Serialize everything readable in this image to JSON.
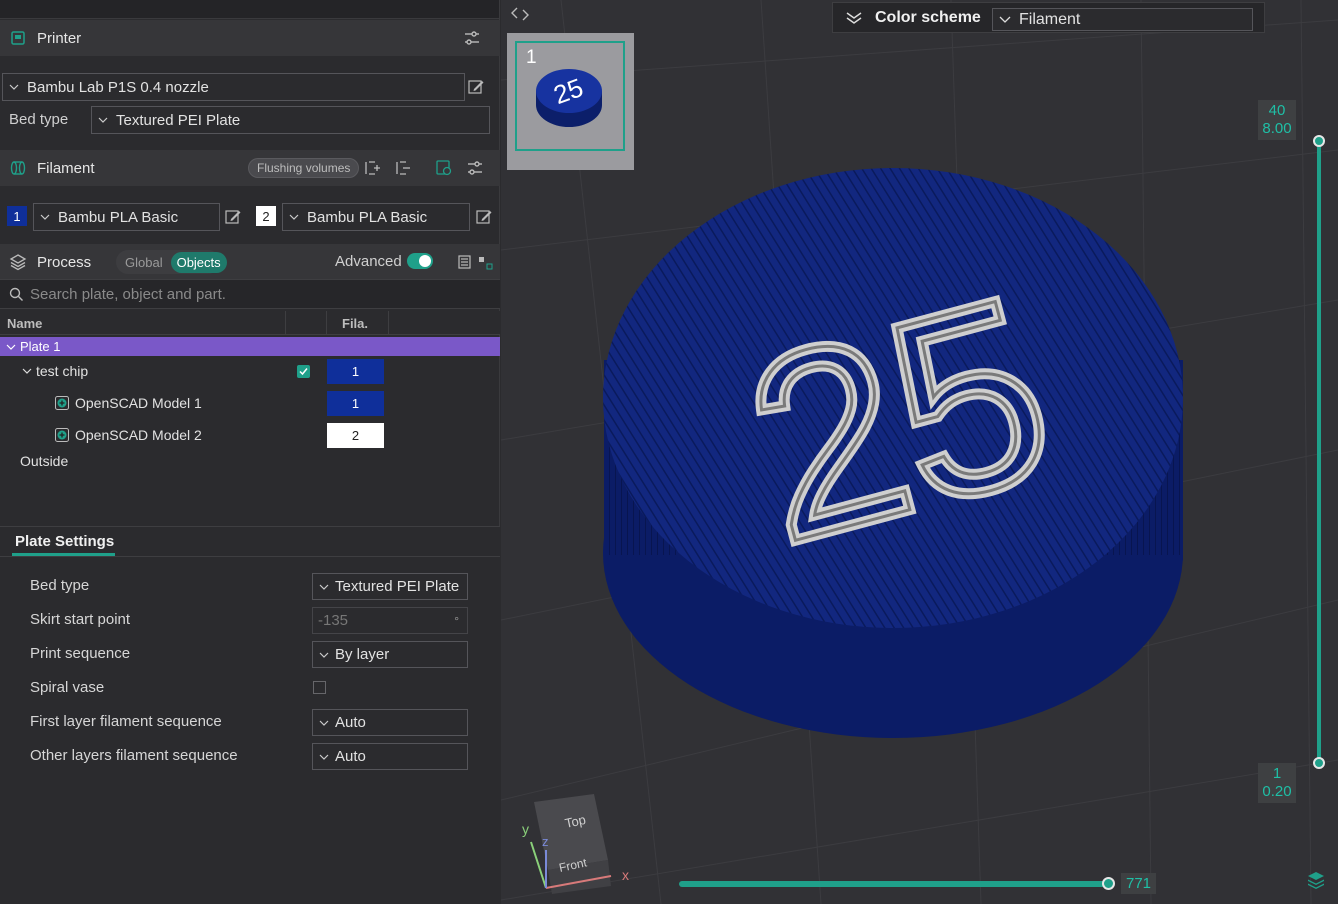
{
  "printer": {
    "title": "Printer",
    "model": "Bambu Lab P1S 0.4 nozzle",
    "bed_type_label": "Bed type",
    "bed_type_value": "Textured PEI Plate"
  },
  "filament": {
    "title": "Filament",
    "flushing_label": "Flushing volumes",
    "items": [
      {
        "index": "1",
        "name": "Bambu PLA Basic",
        "color": "#0f2f9a"
      },
      {
        "index": "2",
        "name": "Bambu PLA Basic",
        "color": "#ffffff"
      }
    ]
  },
  "process": {
    "title": "Process",
    "global_label": "Global",
    "objects_label": "Objects",
    "advanced_label": "Advanced",
    "advanced_on": true
  },
  "search": {
    "placeholder": "Search plate, object and part."
  },
  "object_list": {
    "col_name": "Name",
    "col_fila": "Fila.",
    "plate": "Plate 1",
    "object": {
      "name": "test chip",
      "filament": "1",
      "checked": true
    },
    "parts": [
      {
        "name": "OpenSCAD Model 1",
        "filament": "1"
      },
      {
        "name": "OpenSCAD Model 2",
        "filament": "2"
      }
    ],
    "outside": "Outside"
  },
  "plate_settings": {
    "tab": "Plate Settings",
    "rows": [
      {
        "label": "Bed type",
        "value": "Textured PEI Plate"
      },
      {
        "label": "Skirt start point",
        "value": "-135",
        "unit": "°"
      },
      {
        "label": "Print sequence",
        "value": "By layer"
      },
      {
        "label": "Spiral vase",
        "value": ""
      },
      {
        "label": "First layer filament sequence",
        "value": "Auto"
      },
      {
        "label": "Other layers filament sequence",
        "value": "Auto"
      }
    ]
  },
  "viewport": {
    "plate_thumb_number": "1",
    "color_scheme_label": "Color scheme",
    "color_scheme_value": "Filament",
    "chip_text": "25",
    "layer_top": {
      "layer": "40",
      "height": "8.00"
    },
    "layer_bottom": {
      "layer": "1",
      "height": "0.20"
    },
    "move_value": "771",
    "nav_cube": {
      "top": "Top",
      "front": "Front"
    },
    "axes": {
      "x": "x",
      "y": "y",
      "z": "z"
    },
    "colors": {
      "chip": "#0f2478",
      "text": "#c8c8c8",
      "accent": "#1fa08a"
    }
  }
}
